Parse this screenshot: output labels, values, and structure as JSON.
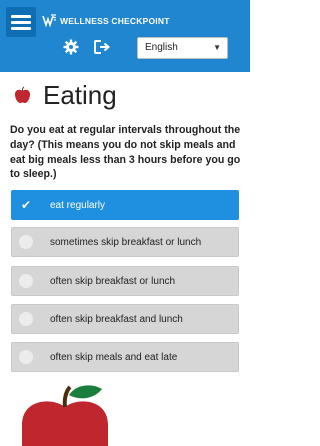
{
  "header": {
    "logo_text": "WELLNESS CHECKPOINT",
    "language_selected": "English",
    "colors": {
      "bar": "#1f86cf",
      "menu_button": "#0f6db3"
    }
  },
  "page": {
    "title": "Eating",
    "question": "Do you eat at regular intervals throughout the day? (This means you do not skip meals and eat big meals less than 3 hours before you go to sleep.)"
  },
  "options": [
    {
      "label": "eat regularly",
      "selected": true
    },
    {
      "label": "sometimes skip breakfast or lunch",
      "selected": false
    },
    {
      "label": "often skip breakfast or lunch",
      "selected": false
    },
    {
      "label": "often skip breakfast and lunch",
      "selected": false
    },
    {
      "label": "often skip meals and eat late",
      "selected": false
    }
  ],
  "colors": {
    "selected_option": "#1f8fdf",
    "unselected_option": "#d6d6d6",
    "apple_red": "#c0262d",
    "leaf_green": "#1a7f3c"
  }
}
